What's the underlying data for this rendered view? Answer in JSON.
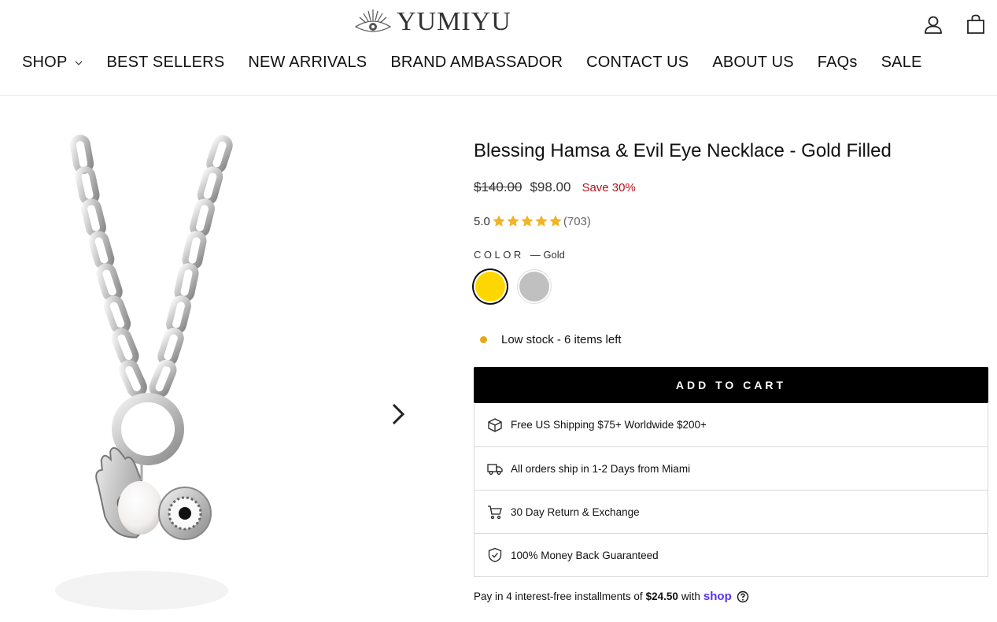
{
  "header": {
    "logo_text": "YUMIYU",
    "account_icon": "user-icon",
    "cart_icon": "shopping-bag-icon"
  },
  "nav": {
    "items": [
      {
        "label": "SHOP",
        "has_dropdown": true
      },
      {
        "label": "BEST SELLERS"
      },
      {
        "label": "NEW ARRIVALS"
      },
      {
        "label": "BRAND AMBASSADOR"
      },
      {
        "label": "CONTACT US"
      },
      {
        "label": "ABOUT US"
      },
      {
        "label": "FAQs"
      },
      {
        "label": "SALE"
      }
    ]
  },
  "product": {
    "title": "Blessing Hamsa & Evil Eye Necklace - Gold Filled",
    "price_original": "$140.00",
    "price_sale": "$98.00",
    "save_label": "Save 30%",
    "rating": "5.0",
    "rating_count": "(703)",
    "stars": 5,
    "color_label": "COLOR",
    "color_value": "— Gold",
    "swatches": [
      {
        "name": "Gold",
        "color": "#ffd700",
        "selected": true
      },
      {
        "name": "Silver",
        "color": "#c0c0c0",
        "selected": false
      }
    ],
    "stock_text": "Low stock - 6 items left",
    "stock_color": "#e6a817",
    "add_to_cart": "ADD TO CART"
  },
  "benefits": [
    {
      "icon": "shipping-box-icon",
      "text": "Free US Shipping $75+ Worldwide $200+"
    },
    {
      "icon": "delivery-truck-icon",
      "text": "All orders ship in 1-2 Days from Miami"
    },
    {
      "icon": "return-cart-icon",
      "text": "30 Day Return & Exchange"
    },
    {
      "icon": "shield-check-icon",
      "text": "100% Money Back Guaranteed"
    }
  ],
  "installments": {
    "prefix": "Pay in 4 interest-free installments of",
    "amount": "$24.50",
    "suffix": "with",
    "brand": "shop"
  },
  "colors": {
    "accent_black": "#000000",
    "sale_red": "#b3131e",
    "star_gold": "#f0b429",
    "shop_purple": "#5a31f4"
  }
}
